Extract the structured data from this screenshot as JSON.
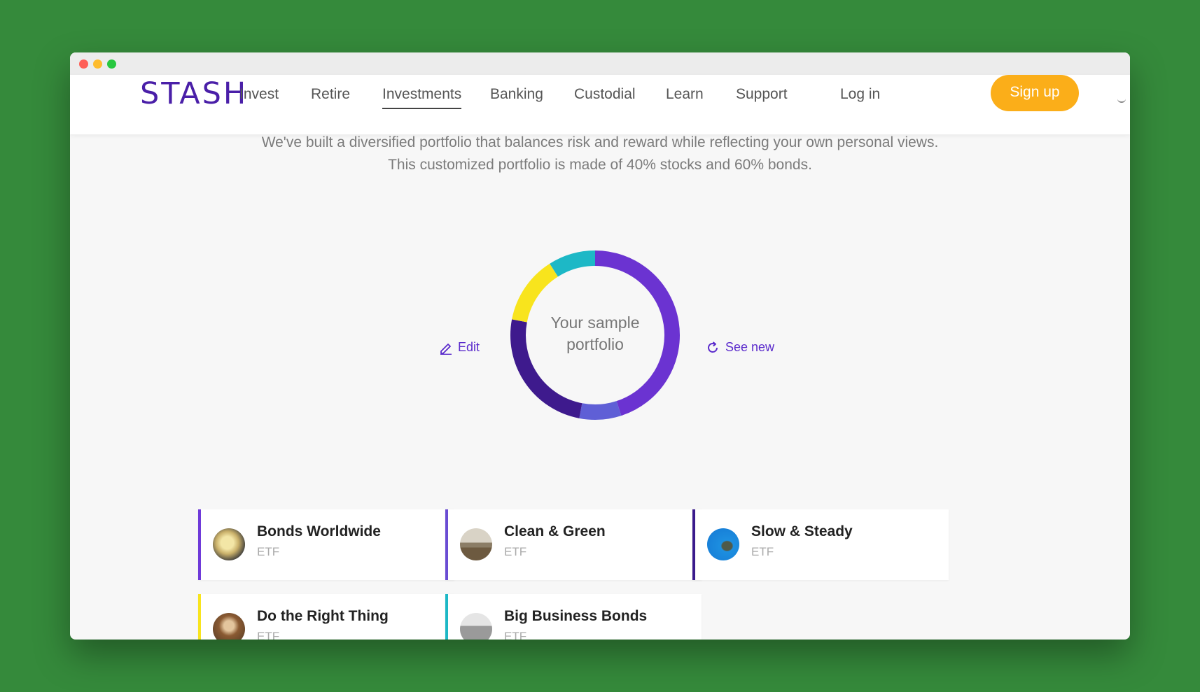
{
  "nav": {
    "logo": "STASH",
    "links": [
      "Invest",
      "Retire",
      "Investments",
      "Banking",
      "Custodial",
      "Learn",
      "Support"
    ],
    "active": "Investments",
    "login": "Log in",
    "signup": "Sign up"
  },
  "intro": {
    "text": "We've built a diversified portfolio that balances risk and reward while reflecting your own personal views. This customized portfolio is made of 40% stocks and 60% bonds."
  },
  "portfolio": {
    "center_line1": "Your sample",
    "center_line2": "portfolio",
    "edit_label": "Edit",
    "see_new_label": "See new",
    "segments": [
      {
        "color": "#6b33d1",
        "fraction": 0.45
      },
      {
        "color": "#5f5fd6",
        "fraction": 0.08
      },
      {
        "color": "#3e1a8d",
        "fraction": 0.25
      },
      {
        "color": "#f8e41d",
        "fraction": 0.13
      },
      {
        "color": "#1db8c6",
        "fraction": 0.09
      }
    ]
  },
  "funds": [
    {
      "name": "Bonds Worldwide",
      "type": "ETF",
      "accent": "#6f3ad9",
      "icon": "coins-photo-icon"
    },
    {
      "name": "Clean & Green",
      "type": "ETF",
      "accent": "#6a4cd3",
      "icon": "wind-farm-photo-icon"
    },
    {
      "name": "Slow & Steady",
      "type": "ETF",
      "accent": "#3a1a8c",
      "icon": "turtle-photo-icon"
    },
    {
      "name": "Do the Right Thing",
      "type": "ETF",
      "accent": "#f8e41d",
      "icon": "people-photo-icon"
    },
    {
      "name": "Big Business Bonds",
      "type": "ETF",
      "accent": "#1db8c6",
      "icon": "city-photo-icon"
    }
  ]
}
